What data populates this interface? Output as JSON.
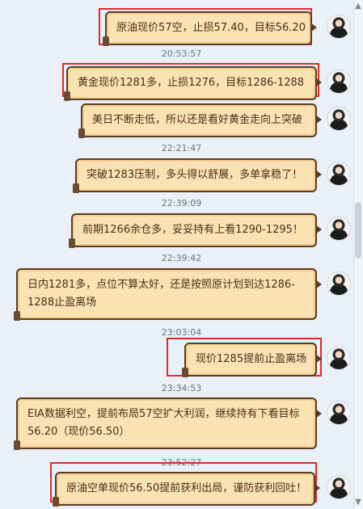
{
  "messages": [
    {
      "text": "原油现价57空，止损57.40，目标56.20"
    },
    {
      "text": "黄金现价1281多，止损1276，目标1286-1288"
    },
    {
      "text": "美日不断走低，所以还是看好黄金走向上突破"
    },
    {
      "text": "突破1283压制，多头得以舒展，多单拿稳了！"
    },
    {
      "text": "前期1266余仓多，妥妥持有上看1290-1295！"
    },
    {
      "text": "日内1281多，点位不算太好，还是按照原计划到达1286-1288止盈离场"
    },
    {
      "text": "现价1285提前止盈离场"
    },
    {
      "text": "EIA数据利空，提前布局57空扩大利润，继续持有下看目标56.20（现价56.50）"
    },
    {
      "text": "原油空单现价56.50提前获利出局，谨防获利回吐！"
    }
  ],
  "timestamps": [
    "20:53:57",
    "22:21:47",
    "22:39:09",
    "22:39:42",
    "23:03:04",
    "23:34:53",
    "23:52:27"
  ],
  "colors": {
    "bubble_bg": "#fbe2b3",
    "bubble_border": "#5a3b24",
    "highlight": "#e02b2b",
    "timestamp": "#6b7280",
    "page_bg": "#e9f0f8"
  },
  "icons": {
    "avatar": "avatar-icon",
    "scroll_up": "chevron-up-icon",
    "scroll_down": "chevron-down-icon"
  }
}
